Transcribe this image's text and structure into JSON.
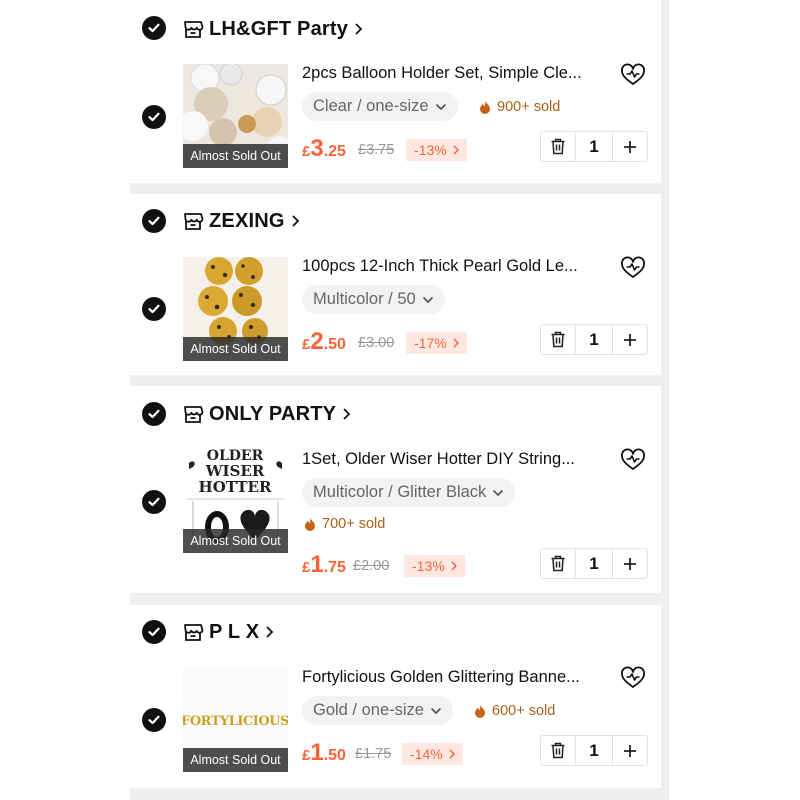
{
  "items": [
    {
      "store": "LH&GFT Party",
      "title": "2pcs Balloon Holder Set, Simple Cle...",
      "variant": "Clear / one-size",
      "sold": "900+ sold",
      "currency": "£",
      "price_int": "3",
      "price_dec": ".25",
      "original_price": "£3.75",
      "discount": "-13%",
      "badge": "Almost Sold Out",
      "quantity": "1",
      "selected": true,
      "image_icon": "cream-balloons-image"
    },
    {
      "store": "ZEXING",
      "title": "100pcs 12-Inch Thick Pearl Gold Le...",
      "variant": "Multicolor / 50",
      "sold": "",
      "currency": "£",
      "price_int": "2",
      "price_dec": ".50",
      "original_price": "£3.00",
      "discount": "-17%",
      "badge": "Almost Sold Out",
      "quantity": "1",
      "selected": true,
      "image_icon": "leopard-gold-balloons-image"
    },
    {
      "store": "ONLY PARTY",
      "title": "1Set, Older Wiser Hotter DIY String...",
      "variant": "Multicolor / Glitter Black",
      "sold": "700+ sold",
      "currency": "£",
      "price_int": "1",
      "price_dec": ".75",
      "original_price": "£2.00",
      "discount": "-13%",
      "badge": "Almost Sold Out",
      "quantity": "1",
      "selected": true,
      "image_icon": "banner-image",
      "image_text": [
        "OLDER",
        "WISER",
        "HOTTER"
      ]
    },
    {
      "store": "P L X",
      "title": "Fortylicious Golden Glittering Banne...",
      "variant": "Gold / one-size",
      "sold": "600+ sold",
      "currency": "£",
      "price_int": "1",
      "price_dec": ".50",
      "original_price": "£1.75",
      "discount": "-14%",
      "badge": "Almost Sold Out",
      "quantity": "1",
      "selected": true,
      "image_icon": "gold-banner-image",
      "image_text": [
        "FORTYLICIOUS"
      ]
    }
  ],
  "colors": {
    "accent_price": "#fa6338",
    "discount_bg": "#ffe8e2",
    "sold_text": "#b06018",
    "check_bg": "#111111"
  }
}
